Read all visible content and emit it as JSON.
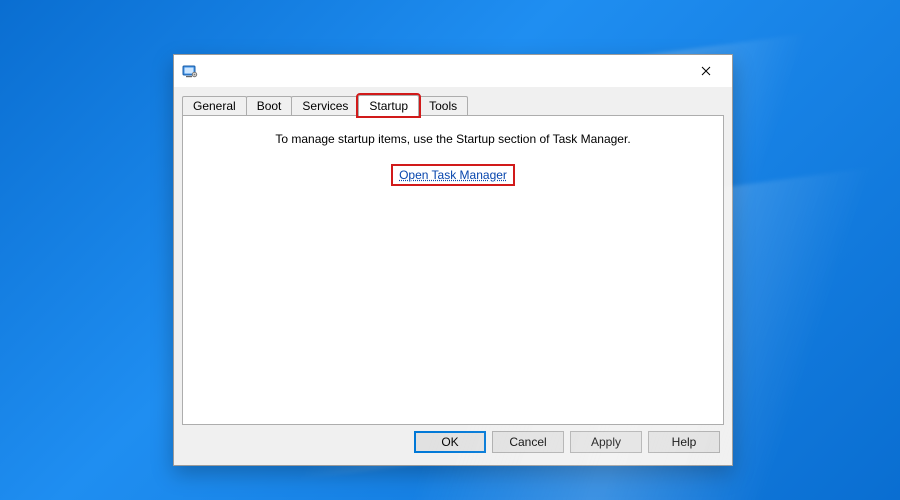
{
  "tabs": {
    "general": "General",
    "boot": "Boot",
    "services": "Services",
    "startup": "Startup",
    "tools": "Tools",
    "active": "startup"
  },
  "startup_pane": {
    "message": "To manage startup items, use the Startup section of Task Manager.",
    "link_label": "Open Task Manager"
  },
  "buttons": {
    "ok": "OK",
    "cancel": "Cancel",
    "apply": "Apply",
    "help": "Help"
  }
}
